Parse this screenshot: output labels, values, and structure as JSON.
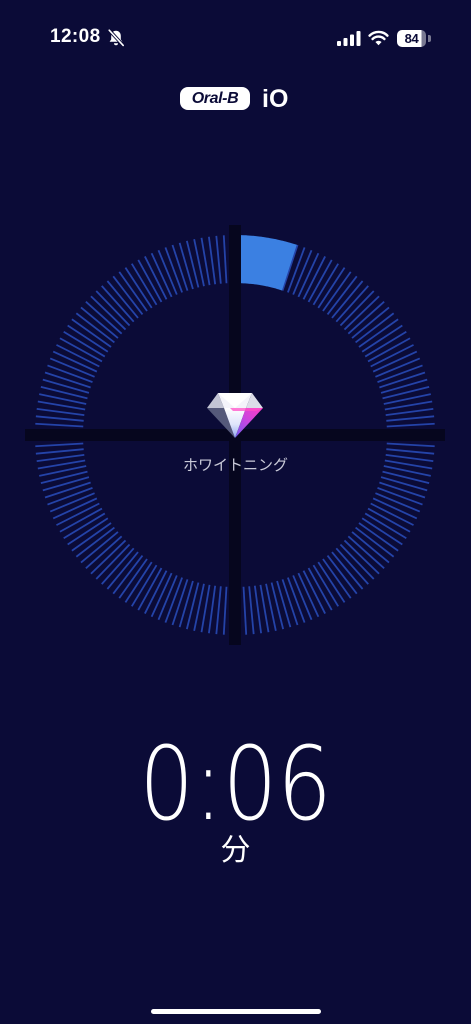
{
  "colors": {
    "background": "#0b0b37",
    "ring_tick": "#2443a8",
    "ring_active": "#3b80e2",
    "divider": "#06061e",
    "text_primary": "#ffffff",
    "text_secondary": "#c9cad8"
  },
  "status_bar": {
    "time": "12:08",
    "silent_icon": "bell-slash-icon",
    "signal_icon": "cellular-signal-icon",
    "signal_bars": 4,
    "wifi_icon": "wifi-icon",
    "wifi_bars": 3,
    "battery_icon": "battery-icon",
    "battery_level": "84"
  },
  "header": {
    "brand": "Oral-B",
    "model": "iO"
  },
  "brushing": {
    "mode_icon": "diamond-icon",
    "mode_label": "ホワイトニング",
    "zone_progress": [
      0.2,
      0,
      0,
      0
    ]
  },
  "timer": {
    "value": "0:06",
    "unit": "分"
  }
}
